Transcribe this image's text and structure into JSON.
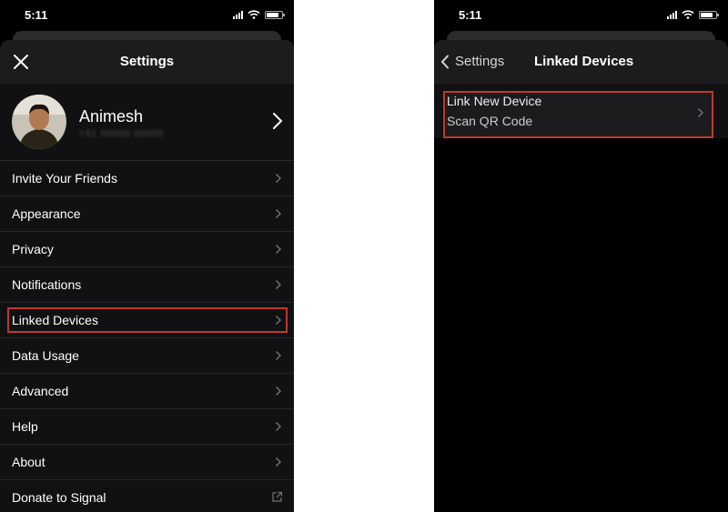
{
  "left": {
    "status_time": "5:11",
    "title": "Settings",
    "profile": {
      "name": "Animesh",
      "phone": "+91 00000 00000"
    },
    "menu": [
      {
        "label": "Invite Your Friends",
        "icon": "chevron-right"
      },
      {
        "label": "Appearance",
        "icon": "chevron-right"
      },
      {
        "label": "Privacy",
        "icon": "chevron-right"
      },
      {
        "label": "Notifications",
        "icon": "chevron-right"
      },
      {
        "label": "Linked Devices",
        "icon": "chevron-right",
        "highlighted": true
      },
      {
        "label": "Data Usage",
        "icon": "chevron-right"
      },
      {
        "label": "Advanced",
        "icon": "chevron-right"
      },
      {
        "label": "Help",
        "icon": "chevron-right"
      },
      {
        "label": "About",
        "icon": "chevron-right"
      },
      {
        "label": "Donate to Signal",
        "icon": "external-link"
      }
    ]
  },
  "right": {
    "status_time": "5:11",
    "back_label": "Settings",
    "title": "Linked Devices",
    "link_row": {
      "line1": "Link New Device",
      "line2": "Scan QR Code"
    }
  },
  "colors": {
    "background": "#000000",
    "nav_background": "#1c1c1e",
    "highlight_border": "#c0392b",
    "text": "#ffffff",
    "chevron": "#6e6e73"
  }
}
